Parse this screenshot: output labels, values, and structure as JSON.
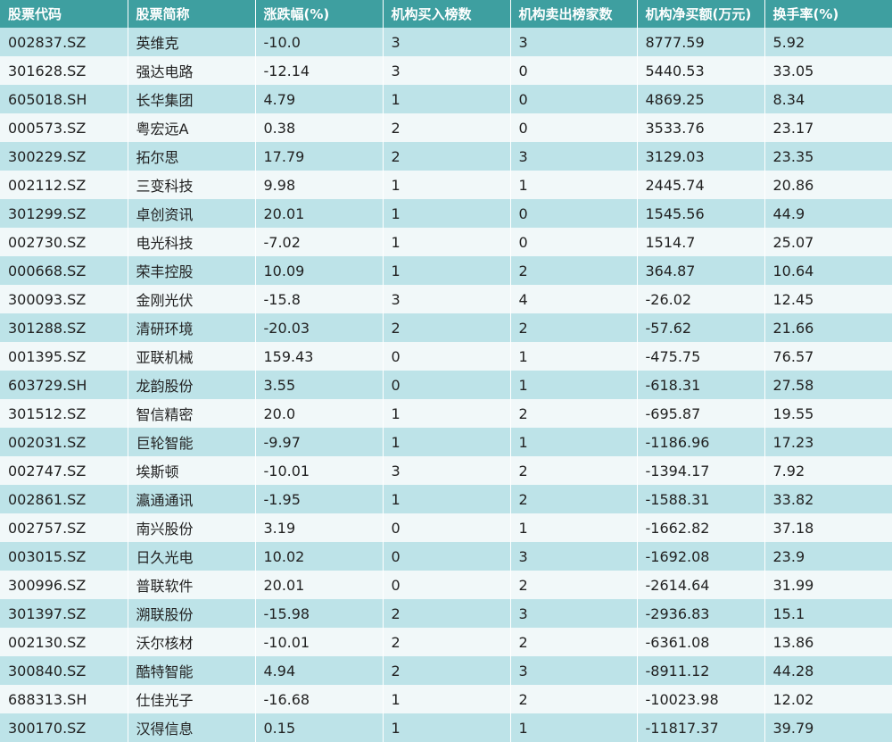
{
  "headers": [
    "股票代码",
    "股票简称",
    "涨跌幅(%)",
    "机构买入榜数",
    "机构卖出榜家数",
    "机构净买额(万元)",
    "换手率(%)"
  ],
  "rows": [
    [
      "002837.SZ",
      "英维克",
      "-10.0",
      "3",
      "3",
      "8777.59",
      "5.92"
    ],
    [
      "301628.SZ",
      "强达电路",
      "-12.14",
      "3",
      "0",
      "5440.53",
      "33.05"
    ],
    [
      "605018.SH",
      "长华集团",
      "4.79",
      "1",
      "0",
      "4869.25",
      "8.34"
    ],
    [
      "000573.SZ",
      "粤宏远A",
      "0.38",
      "2",
      "0",
      "3533.76",
      "23.17"
    ],
    [
      "300229.SZ",
      "拓尔思",
      "17.79",
      "2",
      "3",
      "3129.03",
      "23.35"
    ],
    [
      "002112.SZ",
      "三变科技",
      "9.98",
      "1",
      "1",
      "2445.74",
      "20.86"
    ],
    [
      "301299.SZ",
      "卓创资讯",
      "20.01",
      "1",
      "0",
      "1545.56",
      "44.9"
    ],
    [
      "002730.SZ",
      "电光科技",
      "-7.02",
      "1",
      "0",
      "1514.7",
      "25.07"
    ],
    [
      "000668.SZ",
      "荣丰控股",
      "10.09",
      "1",
      "2",
      "364.87",
      "10.64"
    ],
    [
      "300093.SZ",
      "金刚光伏",
      "-15.8",
      "3",
      "4",
      "-26.02",
      "12.45"
    ],
    [
      "301288.SZ",
      "清研环境",
      "-20.03",
      "2",
      "2",
      "-57.62",
      "21.66"
    ],
    [
      "001395.SZ",
      "亚联机械",
      "159.43",
      "0",
      "1",
      "-475.75",
      "76.57"
    ],
    [
      "603729.SH",
      "龙韵股份",
      "3.55",
      "0",
      "1",
      "-618.31",
      "27.58"
    ],
    [
      "301512.SZ",
      "智信精密",
      "20.0",
      "1",
      "2",
      "-695.87",
      "19.55"
    ],
    [
      "002031.SZ",
      "巨轮智能",
      "-9.97",
      "1",
      "1",
      "-1186.96",
      "17.23"
    ],
    [
      "002747.SZ",
      "埃斯顿",
      "-10.01",
      "3",
      "2",
      "-1394.17",
      "7.92"
    ],
    [
      "002861.SZ",
      "瀛通通讯",
      "-1.95",
      "1",
      "2",
      "-1588.31",
      "33.82"
    ],
    [
      "002757.SZ",
      "南兴股份",
      "3.19",
      "0",
      "1",
      "-1662.82",
      "37.18"
    ],
    [
      "003015.SZ",
      "日久光电",
      "10.02",
      "0",
      "3",
      "-1692.08",
      "23.9"
    ],
    [
      "300996.SZ",
      "普联软件",
      "20.01",
      "0",
      "2",
      "-2614.64",
      "31.99"
    ],
    [
      "301397.SZ",
      "溯联股份",
      "-15.98",
      "2",
      "3",
      "-2936.83",
      "15.1"
    ],
    [
      "002130.SZ",
      "沃尔核材",
      "-10.01",
      "2",
      "2",
      "-6361.08",
      "13.86"
    ],
    [
      "300840.SZ",
      "酷特智能",
      "4.94",
      "2",
      "3",
      "-8911.12",
      "44.28"
    ],
    [
      "688313.SH",
      "仕佳光子",
      "-16.68",
      "1",
      "2",
      "-10023.98",
      "12.02"
    ],
    [
      "300170.SZ",
      "汉得信息",
      "0.15",
      "1",
      "1",
      "-11817.37",
      "39.79"
    ]
  ],
  "colors": {
    "header_bg": "#3e9fa0",
    "row_odd": "#bde3e8",
    "row_even": "#f1f8f9"
  }
}
